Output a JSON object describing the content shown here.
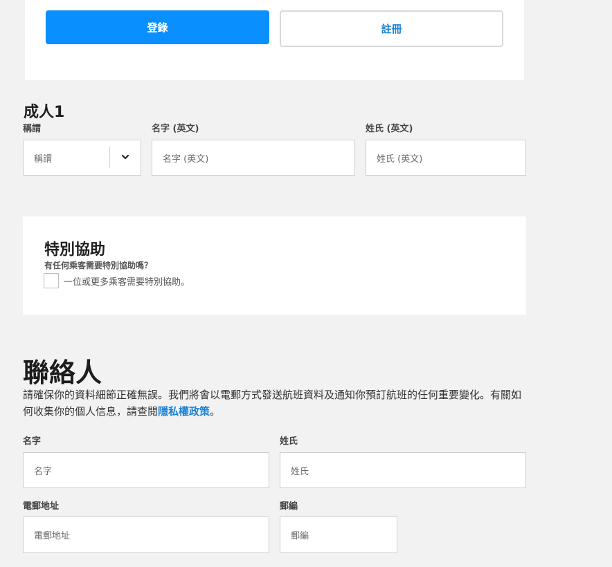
{
  "login": {
    "login_label": "登錄",
    "register_label": "註冊"
  },
  "adult": {
    "title": "成人1",
    "salutation": {
      "label": "稱謂",
      "value": "稱謂"
    },
    "first_name": {
      "label": "名字 (英文)",
      "placeholder": "名字 (英文)"
    },
    "last_name": {
      "label": "姓氏 (英文)",
      "placeholder": "姓氏 (英文)"
    }
  },
  "assistance": {
    "title": "特別協助",
    "question": "有任何乘客需要特別協助嗎？",
    "checkbox_label": "一位或更多乘客需要特別協助。"
  },
  "contact": {
    "title": "聯絡人",
    "description_prefix": "請確保你的資料細節正確無誤。我們將會以電郵方式發送航班資料及通知你預訂航班的任何重要變化。有關如何收集你的個人信息，請查閱",
    "privacy_link": "隱私權政策",
    "description_suffix": "。",
    "first_name": {
      "label": "名字",
      "placeholder": "名字"
    },
    "last_name": {
      "label": "姓氏",
      "placeholder": "姓氏"
    },
    "email": {
      "label": "電郵地址",
      "placeholder": "電郵地址"
    },
    "postcode": {
      "label": "郵編",
      "placeholder": "郵編"
    }
  },
  "colors": {
    "primary": "#0a8fff",
    "link": "#1a83d6",
    "background": "#f2f2f2"
  },
  "icons": {
    "select_chevron": "chevron-down-icon"
  }
}
